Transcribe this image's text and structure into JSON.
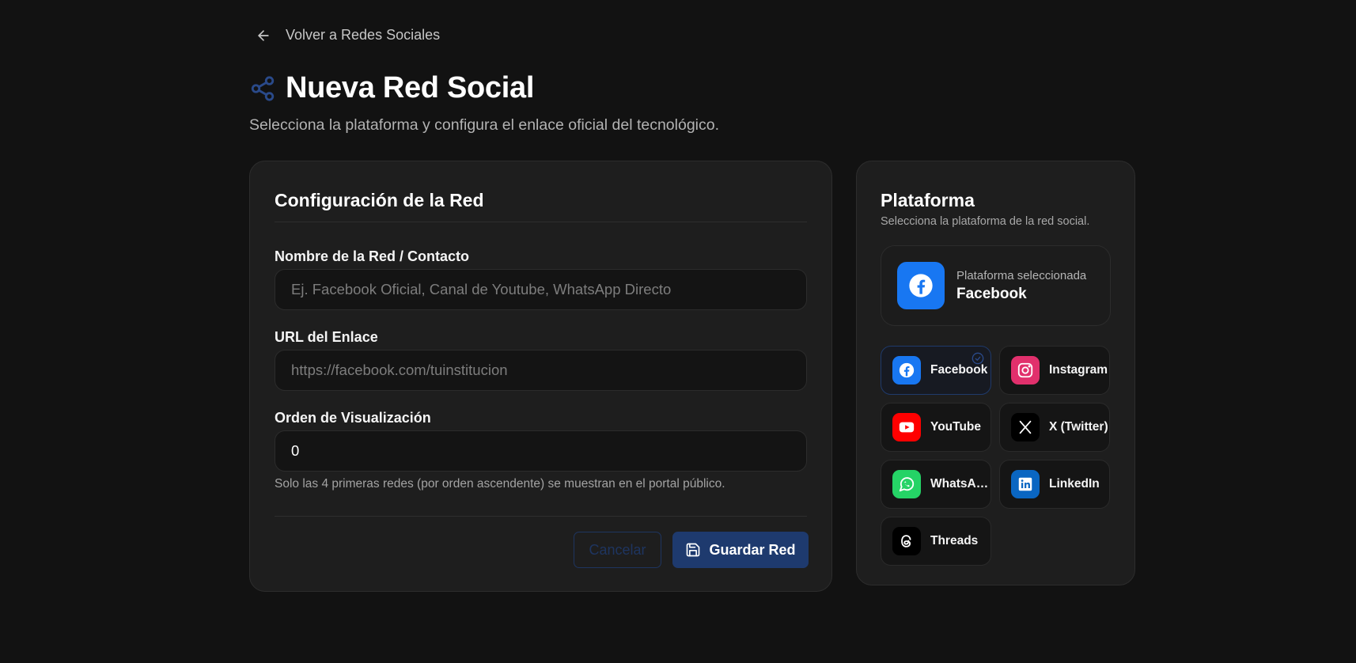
{
  "nav": {
    "back_label": "Volver a Redes Sociales"
  },
  "header": {
    "title": "Nueva Red Social",
    "subtitle": "Selecciona la plataforma y configura el enlace oficial del tecnológico."
  },
  "form": {
    "title": "Configuración de la Red",
    "name_label": "Nombre de la Red / Contacto",
    "name_placeholder": "Ej. Facebook Oficial, Canal de Youtube, WhatsApp Directo",
    "name_value": "",
    "url_label": "URL del Enlace",
    "url_placeholder": "https://facebook.com/tuinstitucion",
    "url_value": "",
    "order_label": "Orden de Visualización",
    "order_value": "0",
    "order_hint": "Solo las 4 primeras redes (por orden ascendente) se muestran en el portal público.",
    "cancel_label": "Cancelar",
    "save_label": "Guardar Red"
  },
  "platform": {
    "title": "Plataforma",
    "subtitle": "Selecciona la plataforma de la red social.",
    "selected_label": "Plataforma seleccionada",
    "selected_name": "Facebook",
    "options": [
      {
        "label": "Facebook",
        "icon": "facebook-icon",
        "color": "#1877f2",
        "selected": true
      },
      {
        "label": "Instagram",
        "icon": "instagram-icon",
        "color": "#e1306c",
        "selected": false
      },
      {
        "label": "YouTube",
        "icon": "youtube-icon",
        "color": "#ff0000",
        "selected": false
      },
      {
        "label": "X (Twitter)",
        "icon": "x-icon",
        "color": "#000000",
        "selected": false
      },
      {
        "label": "WhatsApp",
        "icon": "whatsapp-icon",
        "color": "#25d366",
        "selected": false
      },
      {
        "label": "LinkedIn",
        "icon": "linkedin-icon",
        "color": "#0a66c2",
        "selected": false
      },
      {
        "label": "Threads",
        "icon": "threads-icon",
        "color": "#000000",
        "selected": false
      }
    ]
  },
  "colors": {
    "background": "#121212",
    "card": "#1e1e1e",
    "accent": "#1e3a6e",
    "accent_icon": "#2a4a8a"
  }
}
